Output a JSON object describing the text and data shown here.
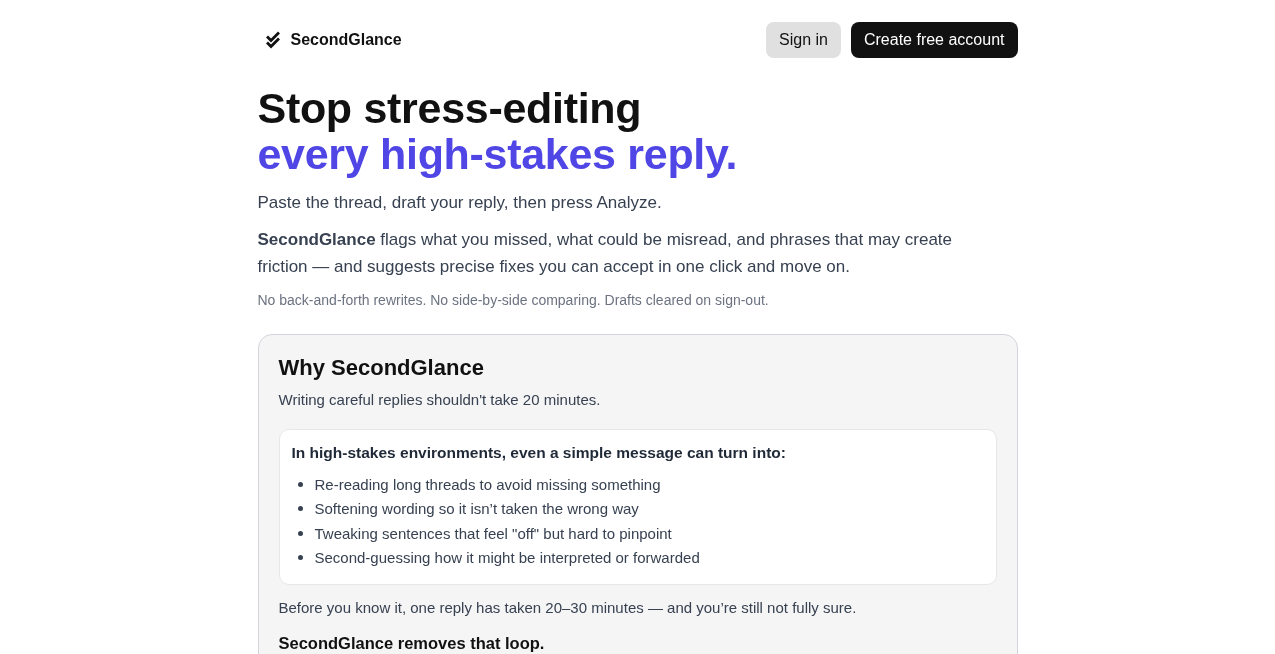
{
  "header": {
    "brand": "SecondGlance",
    "buttons": [
      {
        "label": "Sign in",
        "kind": "secondary"
      },
      {
        "label": "Create free account",
        "kind": "primary"
      }
    ]
  },
  "hero": {
    "headline": "Stop stress-editing",
    "headline_accent": "every high-stakes reply.",
    "intro": "Paste the thread, draft your reply, then press Analyze.",
    "description": "**SecondGlance** flags what you missed, what could be misread, and phrases that may create friction — and suggests precise fixes you can accept in one click and move on.",
    "note": "No back-and-forth rewrites. No side-by-side comparing. Drafts cleared on sign-out."
  },
  "why_card": {
    "title": "Why SecondGlance",
    "subtitle": "Writing careful replies shouldn't take 20 minutes.",
    "problem_box": {
      "heading": "In high-stakes environments, even a simple message can turn into:",
      "items": [
        "Re-reading long threads to avoid missing something",
        "Softening wording so it isn’t taken the wrong way",
        "Tweaking sentences that feel \"off\" but hard to pinpoint",
        "Second-guessing how it might be interpreted or forwarded"
      ]
    },
    "outcome": "Before you know it, one reply has taken 20–30 minutes — and you’re still not fully sure.",
    "closing": "SecondGlance removes that loop."
  }
}
